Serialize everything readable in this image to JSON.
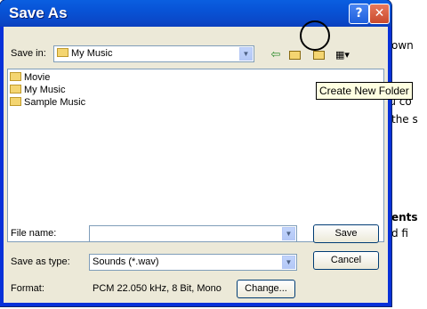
{
  "background_fragments": [
    "own",
    "ou co",
    "the s",
    "ents",
    "d fi"
  ],
  "dialog": {
    "title": "Save As",
    "help_glyph": "?",
    "close_glyph": "✕",
    "save_in_label": "Save in:",
    "save_in_value": "My Music",
    "files": [
      "Movie",
      "My Music",
      "Sample Music"
    ],
    "file_name_label": "File name:",
    "file_name_value": "",
    "save_as_type_label": "Save as type:",
    "save_as_type_value": "Sounds (*.wav)",
    "format_label": "Format:",
    "format_value": "PCM 22.050 kHz, 8 Bit, Mono",
    "save_button": "Save",
    "cancel_button": "Cancel",
    "change_button": "Change...",
    "tooltip": "Create New Folder"
  },
  "icons": [
    "back-icon",
    "up-folder-icon",
    "new-folder-icon",
    "view-menu-icon"
  ]
}
